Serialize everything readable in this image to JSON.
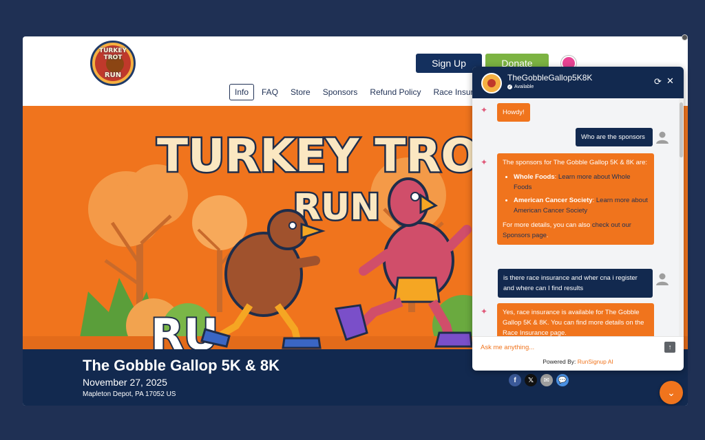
{
  "header": {
    "logo_line1": "TURKEY TROT",
    "logo_line2": "RUN",
    "signup_label": "Sign Up",
    "donate_label": "Donate"
  },
  "nav": [
    {
      "label": "Info",
      "active": true
    },
    {
      "label": "FAQ"
    },
    {
      "label": "Store"
    },
    {
      "label": "Sponsors"
    },
    {
      "label": "Refund Policy"
    },
    {
      "label": "Race Insuran"
    }
  ],
  "hero": {
    "title_line1": "TURKEY TROT",
    "title_line2": "RUN",
    "sign_text": "RU"
  },
  "event": {
    "title": "The Gobble Gallop 5K & 8K",
    "date": "November 27, 2025",
    "location": "Mapleton Depot, PA 17052 US"
  },
  "socials": [
    {
      "icon": "facebook-icon",
      "glyph": "f",
      "color": "#3b5998"
    },
    {
      "icon": "x-icon",
      "glyph": "𝕏",
      "color": "#111111"
    },
    {
      "icon": "email-icon",
      "glyph": "✉",
      "color": "#9e9e9e"
    },
    {
      "icon": "chat-icon",
      "glyph": "💬",
      "color": "#4a90e2"
    }
  ],
  "chat": {
    "name": "TheGobbleGallop5K8K",
    "status": "Available",
    "messages": {
      "bot1": "Howdy!",
      "user1": "Who are the sponsors",
      "bot2_intro": "The sponsors for The Gobble Gallop 5K & 8K are:",
      "sponsor1_name": "Whole Foods",
      "sponsor1_link": "Learn more about Whole Foods",
      "sponsor2_name": "American Cancer Society",
      "sponsor2_link": "Learn more about American Cancer Society",
      "bot2_outro": "For more details, you can also",
      "bot2_outro_link": "check out our Sponsors page",
      "user2": "is there race insurance and wher cna i register and where can I find results",
      "bot3": "Yes, race insurance is available for The Gobble Gallop 5K & 8K. You can find more details on the Race Insurance page."
    },
    "input_placeholder": "Ask me anything...",
    "powered_prefix": "Powered By:",
    "powered_brand": "RunSignup AI"
  },
  "colors": {
    "navy": "#12294f",
    "orange": "#f0741d",
    "green": "#7cb342",
    "background": "#1f3054"
  }
}
